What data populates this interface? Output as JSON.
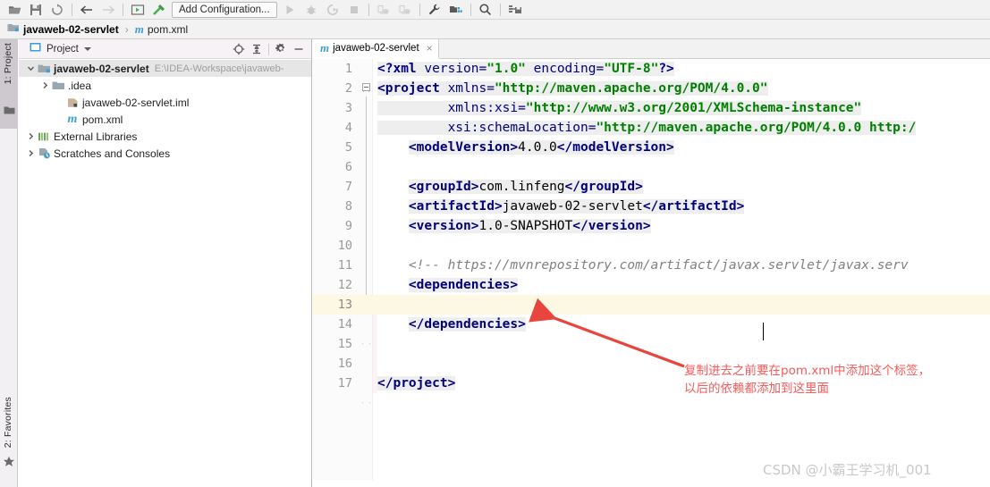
{
  "toolbar": {
    "icons_left": [
      "open-folder-icon",
      "save-icon",
      "sync-icon"
    ],
    "nav_icons": [
      "back-arrow-icon",
      "forward-arrow-icon"
    ],
    "run_icons": [
      "run-config-icon",
      "build-hammer-icon"
    ],
    "config_label": "Add Configuration...",
    "right_icons": [
      "run-icon",
      "debug-icon",
      "run-coverage-icon",
      "stop-icon",
      "profile-icon",
      "profile-cpu-icon",
      "wrench-icon",
      "structure-icon",
      "search-icon",
      "vcs-update-icon"
    ]
  },
  "breadcrumb": {
    "project_icon": "module-icon",
    "project": "javaweb-02-servlet",
    "separator": "›",
    "file_icon": "maven-m-icon",
    "file_icon_glyph": "m",
    "file": "pom.xml"
  },
  "rail": {
    "project_label": "1: Project",
    "project_icon": "folder-icon",
    "favorites_label": "2: Favorites",
    "favorites_icon": "star-icon"
  },
  "project_panel": {
    "icon": "project-window-icon",
    "title": "Project",
    "caret": "chevron-down-icon",
    "actions": [
      "locate-target-icon",
      "collapse-all-icon",
      "settings-gear-icon",
      "hide-minimize-icon"
    ],
    "tree": [
      {
        "indent": 0,
        "twisty": "⌄",
        "expanded": true,
        "icon": "module-icon",
        "label": "javaweb-02-servlet",
        "bold": true,
        "path": "E:\\IDEA-Workspace\\javaweb-",
        "selected": true
      },
      {
        "indent": 1,
        "twisty": "›",
        "expanded": false,
        "icon": "folder-icon",
        "label": ".idea",
        "bold": false,
        "path": "",
        "selected": false
      },
      {
        "indent": 2,
        "twisty": "",
        "expanded": false,
        "icon": "iml-module-icon",
        "label": "javaweb-02-servlet.iml",
        "bold": false,
        "path": "",
        "selected": false
      },
      {
        "indent": 2,
        "twisty": "",
        "expanded": false,
        "icon": "maven-m-icon",
        "label": "pom.xml",
        "bold": false,
        "path": "",
        "selected": false
      },
      {
        "indent": 0,
        "twisty": "›",
        "expanded": false,
        "icon": "libraries-icon",
        "label": "External Libraries",
        "bold": false,
        "path": "",
        "selected": false
      },
      {
        "indent": 0,
        "twisty": "›",
        "expanded": false,
        "icon": "scratches-icon",
        "label": "Scratches and Consoles",
        "bold": false,
        "path": "",
        "selected": false
      }
    ]
  },
  "editor": {
    "tab": {
      "icon": "maven-m-icon",
      "icon_glyph": "m",
      "label": "javaweb-02-servlet",
      "close": "×"
    },
    "lines": [
      {
        "n": "1",
        "indent": 0,
        "highlight": false,
        "tokens": [
          {
            "t": "<?",
            "c": "tk-pi",
            "bg": true
          },
          {
            "t": "xml",
            "c": "tk-pi",
            "bg": true
          },
          {
            "t": " version=",
            "c": "tk-attr",
            "bg": true
          },
          {
            "t": "\"1.0\"",
            "c": "tk-val",
            "bg": true
          },
          {
            "t": " encoding=",
            "c": "tk-attr",
            "bg": true
          },
          {
            "t": "\"UTF-8\"",
            "c": "tk-val",
            "bg": true
          },
          {
            "t": "?>",
            "c": "tk-pi",
            "bg": true
          }
        ]
      },
      {
        "n": "2",
        "indent": 0,
        "highlight": false,
        "tokens": [
          {
            "t": "<project",
            "c": "tk-tag",
            "bg": true
          },
          {
            "t": " xmlns=",
            "c": "tk-attr",
            "bg": true
          },
          {
            "t": "\"http://maven.apache.org/POM/4.0.0\"",
            "c": "tk-val",
            "bg": true
          }
        ]
      },
      {
        "n": "3",
        "indent": 0,
        "highlight": false,
        "tokens": [
          {
            "t": "         xmlns:xsi=",
            "c": "tk-attr",
            "bg": true
          },
          {
            "t": "\"http://www.w3.org/2001/XMLSchema-instance\"",
            "c": "tk-val",
            "bg": true
          }
        ]
      },
      {
        "n": "4",
        "indent": 0,
        "highlight": false,
        "tokens": [
          {
            "t": "         xsi:schemaLocation=",
            "c": "tk-attr",
            "bg": true
          },
          {
            "t": "\"http://maven.apache.org/POM/4.0.0 http:/",
            "c": "tk-val",
            "bg": true
          }
        ]
      },
      {
        "n": "5",
        "indent": 0,
        "highlight": false,
        "tokens": [
          {
            "t": "    ",
            "c": "tk-txt",
            "bg": false
          },
          {
            "t": "<modelVersion>",
            "c": "tk-tag",
            "bg": true
          },
          {
            "t": "4.0.0",
            "c": "tk-txt",
            "bg": true
          },
          {
            "t": "</modelVersion>",
            "c": "tk-tag",
            "bg": true
          }
        ]
      },
      {
        "n": "6",
        "indent": 0,
        "highlight": false,
        "tokens": []
      },
      {
        "n": "7",
        "indent": 0,
        "highlight": false,
        "tokens": [
          {
            "t": "    ",
            "c": "tk-txt",
            "bg": false
          },
          {
            "t": "<groupId>",
            "c": "tk-tag",
            "bg": true
          },
          {
            "t": "com.linfeng",
            "c": "tk-txt",
            "bg": true
          },
          {
            "t": "</groupId>",
            "c": "tk-tag",
            "bg": true
          }
        ]
      },
      {
        "n": "8",
        "indent": 0,
        "highlight": false,
        "tokens": [
          {
            "t": "    ",
            "c": "tk-txt",
            "bg": false
          },
          {
            "t": "<artifactId>",
            "c": "tk-tag",
            "bg": true
          },
          {
            "t": "javaweb-02-servlet",
            "c": "tk-txt",
            "bg": true
          },
          {
            "t": "</artifactId>",
            "c": "tk-tag",
            "bg": true
          }
        ]
      },
      {
        "n": "9",
        "indent": 0,
        "highlight": false,
        "tokens": [
          {
            "t": "    ",
            "c": "tk-txt",
            "bg": false
          },
          {
            "t": "<version>",
            "c": "tk-tag",
            "bg": true
          },
          {
            "t": "1.0-SNAPSHOT",
            "c": "tk-txt",
            "bg": true
          },
          {
            "t": "</version>",
            "c": "tk-tag",
            "bg": true
          }
        ]
      },
      {
        "n": "10",
        "indent": 0,
        "highlight": false,
        "tokens": []
      },
      {
        "n": "11",
        "indent": 0,
        "highlight": false,
        "tokens": [
          {
            "t": "    ",
            "c": "tk-txt",
            "bg": false
          },
          {
            "t": "<!-- https://mvnrepository.com/artifact/javax.servlet/javax.serv",
            "c": "tk-cmt",
            "bg": false
          }
        ]
      },
      {
        "n": "12",
        "indent": 0,
        "highlight": false,
        "tokens": [
          {
            "t": "    ",
            "c": "tk-txt",
            "bg": false
          },
          {
            "t": "<dependencies>",
            "c": "tk-tag",
            "bg": true
          }
        ]
      },
      {
        "n": "13",
        "indent": 0,
        "highlight": true,
        "tokens": []
      },
      {
        "n": "14",
        "indent": 0,
        "highlight": false,
        "tokens": [
          {
            "t": "    ",
            "c": "tk-txt",
            "bg": false
          },
          {
            "t": "</dependencies>",
            "c": "tk-tag",
            "bg": true
          }
        ]
      },
      {
        "n": "15",
        "indent": 0,
        "highlight": false,
        "tokens": []
      },
      {
        "n": "16",
        "indent": 0,
        "highlight": false,
        "tokens": []
      },
      {
        "n": "17",
        "indent": 0,
        "highlight": false,
        "tokens": [
          {
            "t": "</project>",
            "c": "tk-tag",
            "bg": true
          }
        ]
      }
    ]
  },
  "annotation": {
    "line1": "复制进去之前要在pom.xml中添加这个标签，",
    "line2": "以后的依赖都添加到这里面",
    "color": "#fa5a5a",
    "arrow_name": "red-pointer-arrow"
  },
  "watermark": {
    "text": "CSDN @小霸王学习机_001"
  }
}
